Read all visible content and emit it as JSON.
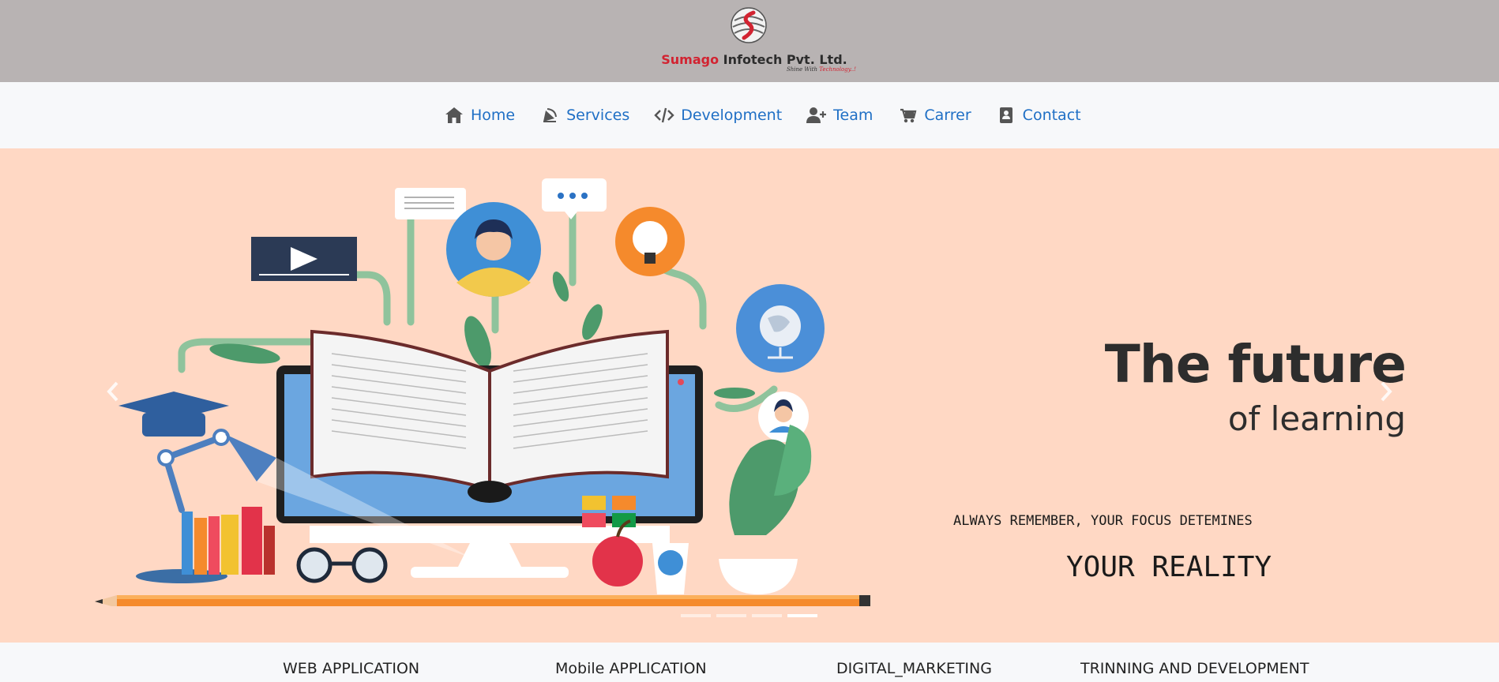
{
  "brand": {
    "name_part1": "Sumago",
    "name_part2": "Infotech Pvt. Ltd.",
    "tagline_part1": "Shine With",
    "tagline_part2": "Technology..!",
    "colors": {
      "red": "#d22331",
      "dark": "#2c2c2c",
      "header_bg": "#b8b3b3"
    }
  },
  "nav": {
    "items": [
      {
        "label": "Home",
        "icon": "home-icon"
      },
      {
        "label": "Services",
        "icon": "services-icon"
      },
      {
        "label": "Development",
        "icon": "code-icon"
      },
      {
        "label": "Team",
        "icon": "user-plus-icon"
      },
      {
        "label": "Carrer",
        "icon": "career-icon"
      },
      {
        "label": "Contact",
        "icon": "contact-book-icon"
      }
    ],
    "link_color": "#1f6fc5"
  },
  "hero": {
    "title_line1": "The future",
    "title_line2": "of learning",
    "quote_line1": "ALWAYS REMEMBER, YOUR FOCUS DETEMINES",
    "quote_line2": "YOUR REALITY",
    "background": "#ffd8c4",
    "slide_count": 4,
    "active_slide": 4,
    "prev_icon": "chevron-left-icon",
    "next_icon": "chevron-right-icon"
  },
  "services": {
    "items": [
      "WEB APPLICATION",
      "Mobile APPLICATION",
      "DIGITAL_MARKETING",
      "TRINNING AND DEVELOPMENT"
    ]
  }
}
